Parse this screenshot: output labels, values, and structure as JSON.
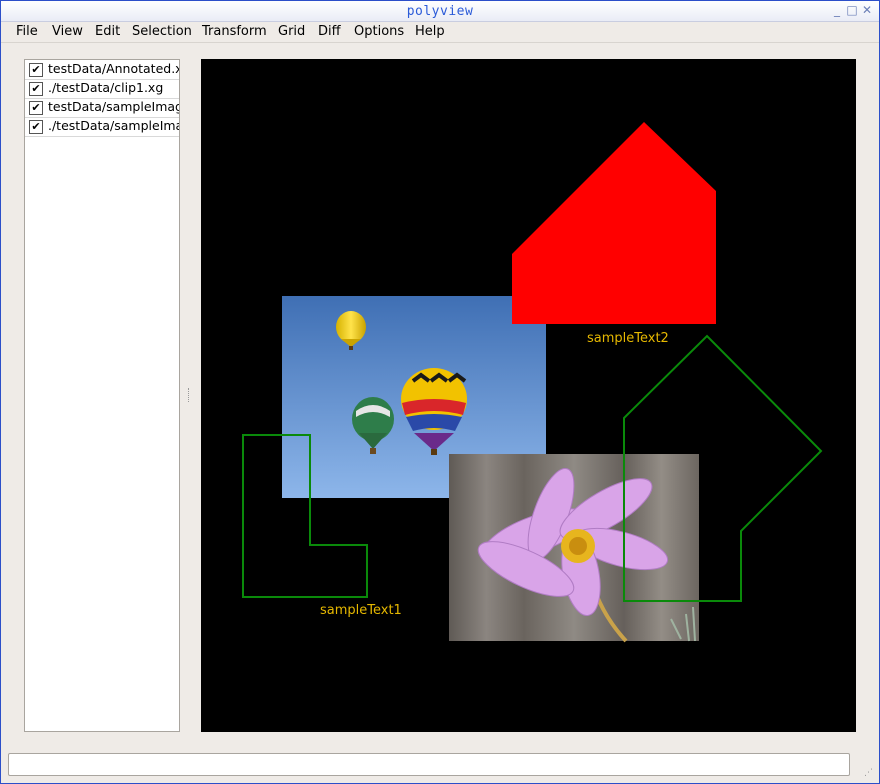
{
  "window": {
    "title": "polyview",
    "controls": [
      "_",
      "□",
      "✕"
    ]
  },
  "menu": [
    "File",
    "View",
    "Edit",
    "Selection",
    "Transform",
    "Grid",
    "Diff",
    "Options",
    "Help"
  ],
  "files": [
    {
      "label": "testData/Annotated.x",
      "checked": true
    },
    {
      "label": "./testData/clip1.xg",
      "checked": true
    },
    {
      "label": "testData/sampleImag",
      "checked": true
    },
    {
      "label": "./testData/sampleIma",
      "checked": true
    }
  ],
  "canvas": {
    "labels": {
      "text1": "sampleText1",
      "text2": "sampleText2"
    },
    "colors": {
      "background": "#000000",
      "filled_polygon": "#ff0000",
      "outline_polygon": "#0a8a0a",
      "text": "#e6b800"
    },
    "images": [
      "hot-air-balloons-photo",
      "pink-cosmos-flower-photo"
    ]
  },
  "status": {
    "text": ""
  }
}
